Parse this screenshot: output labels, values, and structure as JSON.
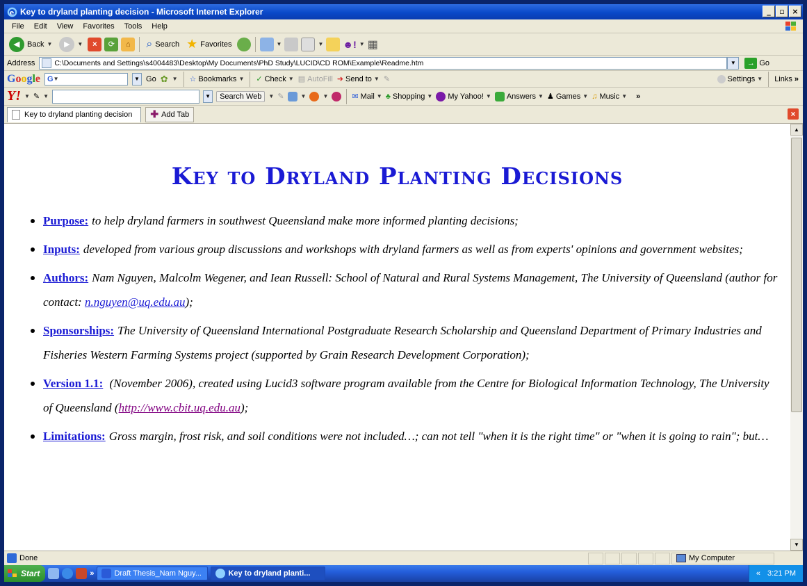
{
  "window": {
    "title": "Key to dryland planting decision - Microsoft Internet Explorer"
  },
  "menu": [
    "File",
    "Edit",
    "View",
    "Favorites",
    "Tools",
    "Help"
  ],
  "toolbar": {
    "back": "Back",
    "search": "Search",
    "favorites": "Favorites"
  },
  "address": {
    "label": "Address",
    "url": "C:\\Documents and Settings\\s4004483\\Desktop\\My Documents\\PhD Study\\LUCID\\CD ROM\\Example\\Readme.htm",
    "go": "Go"
  },
  "google": {
    "logo": "Google",
    "go": "Go",
    "bookmarks": "Bookmarks",
    "check": "Check",
    "autofill": "AutoFill",
    "send_to": "Send to",
    "settings": "Settings",
    "links": "Links"
  },
  "yahoo": {
    "logo": "Y!",
    "search_web": "Search Web",
    "mail": "Mail",
    "shopping": "Shopping",
    "my_yahoo": "My Yahoo!",
    "answers": "Answers",
    "games": "Games",
    "music": "Music"
  },
  "tabs": {
    "active": "Key to dryland planting decision",
    "add": "Add Tab"
  },
  "page": {
    "title": "Key to Dryland Planting Decisions",
    "items": [
      {
        "label": "Purpose:",
        "text": "to help dryland farmers in southwest Queensland make more informed planting decisions;"
      },
      {
        "label": "Inputs:",
        "text": "developed from various group discussions and workshops with dryland farmers as well as from experts' opinions and government websites;"
      },
      {
        "label": "Authors:",
        "text": "Nam Nguyen, Malcolm Wegener, and Iean Russell: School of Natural and Rural Systems Management, The University of Queensland (author for contact: ",
        "link": "n.nguyen@uq.edu.au",
        "tail": ");"
      },
      {
        "label": "Sponsorships:",
        "text": "The University of Queensland International Postgraduate Research Scholarship and Queensland Department of Primary Industries and Fisheries Western Farming Systems project (supported by Grain Research Development Corporation);"
      },
      {
        "label": "Version 1.1:",
        "text": " (November 2006), created using Lucid3 software program available from the Centre for Biological Information Technology, The University of Queensland (",
        "link": "http://www.cbit.uq.edu.au",
        "tail": ");"
      },
      {
        "label": "Limitations:",
        "text": "Gross margin, frost risk, and soil conditions were not included…; can not tell \"when it is the right time\" or \"when it is going to rain\"; but…"
      }
    ]
  },
  "status": {
    "text": "Done",
    "zone": "My Computer"
  },
  "taskbar": {
    "start": "Start",
    "task1": "Draft Thesis_Nam Nguy...",
    "task2": "Key to dryland planti...",
    "clock": "3:21 PM"
  }
}
